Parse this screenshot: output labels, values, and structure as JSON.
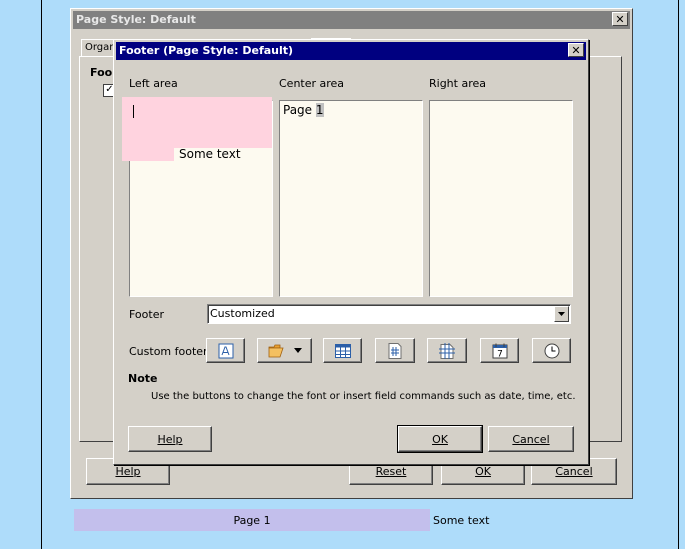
{
  "page_style_dialog": {
    "title": "Page Style: Default",
    "tab_organizer": "Organ",
    "section_footer": "Foo",
    "help_label": "Help",
    "reset_label": "Reset",
    "ok_label": "OK",
    "cancel_label": "Cancel"
  },
  "footer_dialog": {
    "title": "Footer (Page Style: Default)",
    "left_area_label": "Left area",
    "center_area_label": "Center area",
    "right_area_label": "Right area",
    "left_area_text": "Some text",
    "center_area_text_prefix": "Page ",
    "center_area_field": "1",
    "footer_label": "Footer",
    "footer_select_value": "Customized",
    "custom_footer_label": "Custom footer",
    "note_heading": "Note",
    "note_text": "Use the buttons to change the font or insert field commands such as date, time, etc.",
    "help_label": "Help",
    "ok_label": "OK",
    "cancel_label": "Cancel"
  },
  "document_footer": {
    "center_text": "Page 1",
    "right_text": "Some text"
  },
  "colors": {
    "desktop": "#aedcfa",
    "active_title": "#000080",
    "inactive_title": "#808080",
    "dialog_face": "#d4d0c8",
    "area_background": "#fdfaf0",
    "selection_pink": "#ffd3df",
    "footer_highlight": "#c3bfec"
  },
  "icons": [
    "font-attributes-icon",
    "open-folder-icon",
    "insert-table-icon",
    "page-number-icon",
    "page-count-icon",
    "date-icon",
    "time-icon"
  ]
}
